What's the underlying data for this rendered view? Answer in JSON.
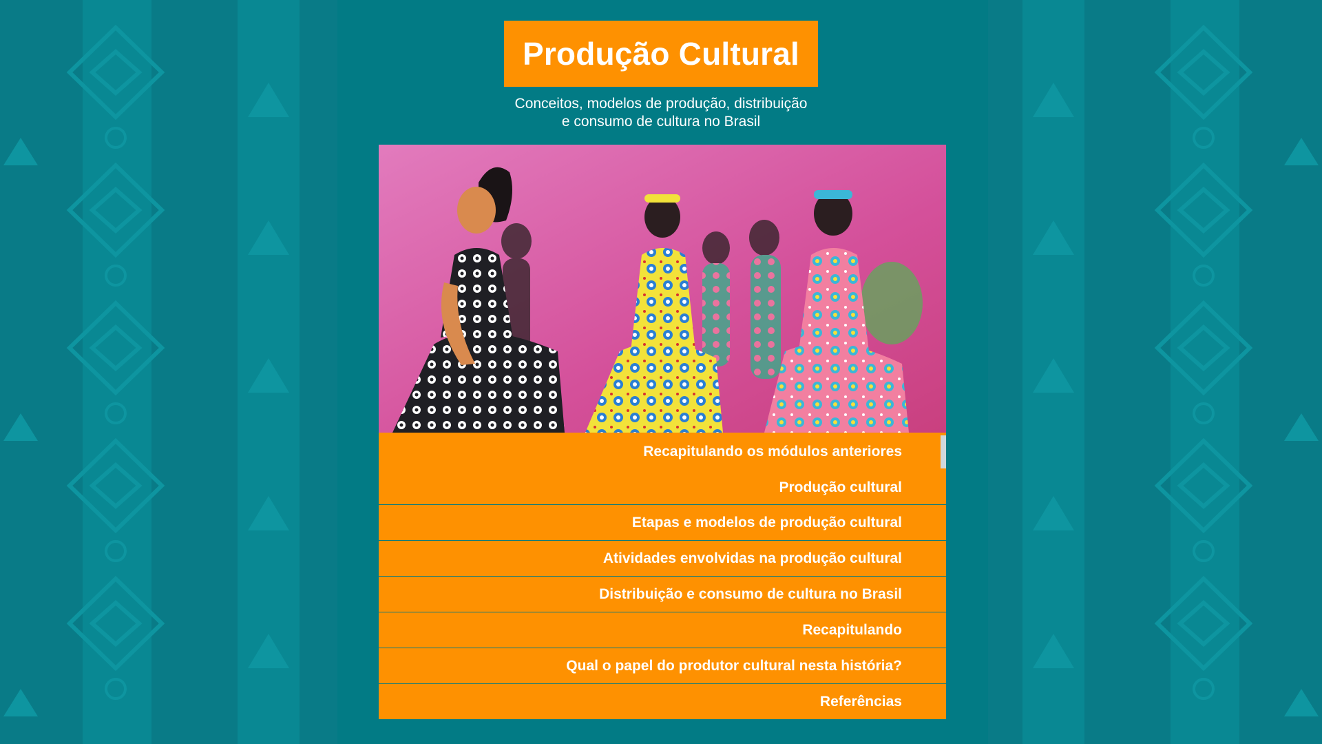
{
  "header": {
    "title": "Produção Cultural",
    "subtitle_line1": "Conceitos, modelos de produção, distribuição",
    "subtitle_line2": "e consumo de cultura no Brasil"
  },
  "colors": {
    "background_teal": "#087a86",
    "panel_teal": "#027b85",
    "accent_orange": "#fe9101",
    "text_white": "#ffffff"
  },
  "menu": {
    "items": [
      {
        "label": "Recapitulando os módulos anteriores"
      },
      {
        "label": "Produção cultural"
      },
      {
        "label": "Etapas e modelos de produção cultural"
      },
      {
        "label": "Atividades envolvidas na produção cultural"
      },
      {
        "label": "Distribuição e consumo de cultura no Brasil"
      },
      {
        "label": "Recapitulando"
      },
      {
        "label": "Qual o papel do produtor cultural nesta história?"
      },
      {
        "label": "Referências"
      }
    ]
  }
}
